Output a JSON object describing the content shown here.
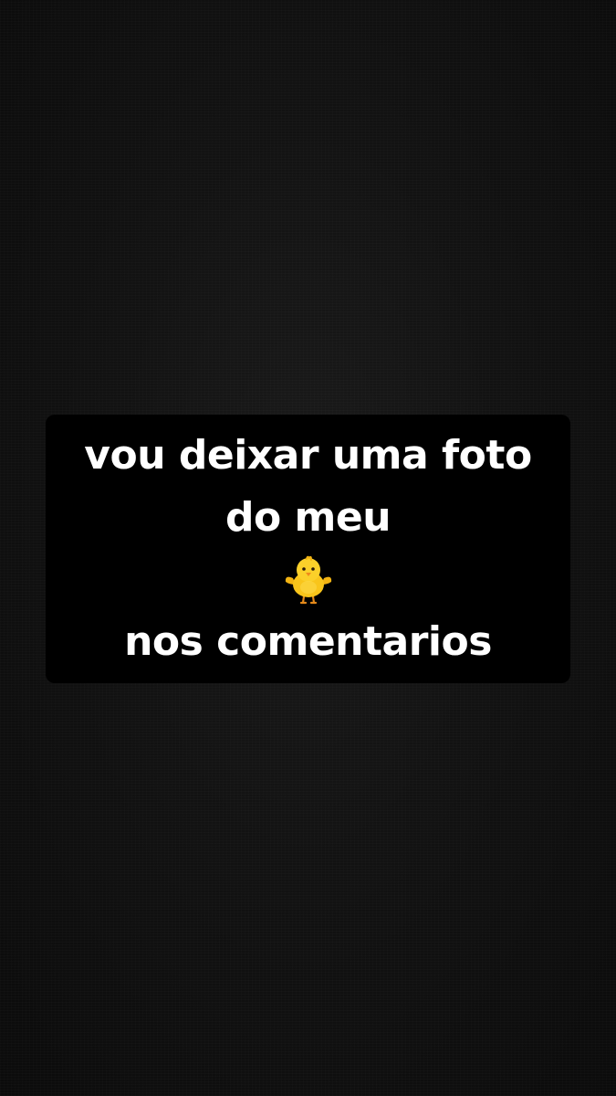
{
  "story": {
    "caption": {
      "line1": "vou deixar uma foto",
      "line2": "do meu",
      "emoji": "baby-chick-icon",
      "line3": "nos comentarios"
    }
  },
  "colors": {
    "background": "#0d0d0d",
    "caption_box": "#000000",
    "caption_text": "#ffffff",
    "chick_body": "#f9c51b",
    "chick_beak": "#f08a1c"
  }
}
